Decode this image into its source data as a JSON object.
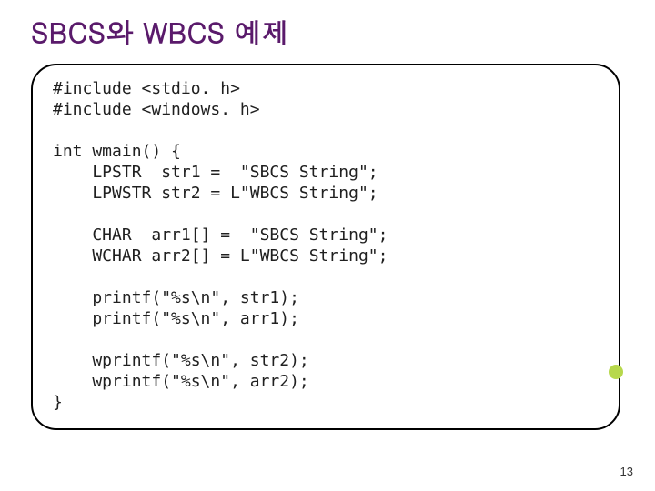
{
  "title": "SBCS와 WBCS 예제",
  "code": "#include <stdio. h>\n#include <windows. h>\n\nint wmain() {\n    LPSTR  str1 =  \"SBCS String\";\n    LPWSTR str2 = L\"WBCS String\";\n\n    CHAR  arr1[] =  \"SBCS String\";\n    WCHAR arr2[] = L\"WBCS String\";\n\n    printf(\"%s\\n\", str1);\n    printf(\"%s\\n\", arr1);\n\n    wprintf(\"%s\\n\", str2);\n    wprintf(\"%s\\n\", arr2);\n}",
  "page_number": "13"
}
